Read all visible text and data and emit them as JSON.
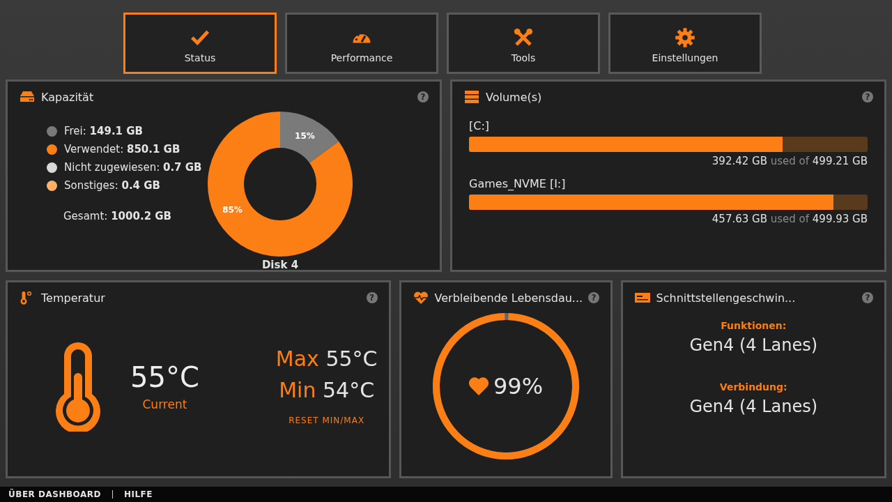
{
  "tabs": [
    {
      "label": "Status",
      "selected": true
    },
    {
      "label": "Performance",
      "selected": false
    },
    {
      "label": "Tools",
      "selected": false
    },
    {
      "label": "Einstellungen",
      "selected": false
    }
  ],
  "capacity": {
    "title": "Kapazität",
    "help": "?",
    "legend": [
      {
        "label": "Frei:",
        "value": "149.1 GB",
        "color": "#7a7a7a"
      },
      {
        "label": "Verwendet:",
        "value": "850.1 GB",
        "color": "#fb7f14"
      },
      {
        "label": "Nicht zugewiesen:",
        "value": "0.7 GB",
        "color": "#d9d9d9"
      },
      {
        "label": "Sonstiges:",
        "value": "0.4 GB",
        "color": "#fdb068"
      }
    ],
    "total_label": "Gesamt:",
    "total_value": "1000.2 GB",
    "disk": "Disk 4",
    "chart_data": {
      "type": "donut",
      "values": [
        15,
        85
      ],
      "value_labels": [
        "15%",
        "85%"
      ]
    }
  },
  "volumes": {
    "title": "Volume(s)",
    "help": "?",
    "items": [
      {
        "name": "[C:]",
        "level": 0.786,
        "used": "392.42 GB",
        "mid": "used of",
        "total": "499.21 GB"
      },
      {
        "name": "Games_NVME [I:]",
        "level": 0.915,
        "used": "457.63 GB",
        "mid": "used of",
        "total": "499.93 GB"
      }
    ]
  },
  "temperature": {
    "title": "Temperatur",
    "help": "?",
    "current": "55°C",
    "current_label": "Current",
    "max_label": "Max",
    "max": "55°C",
    "min_label": "Min",
    "min": "54°C",
    "reset": "RESET MIN/MAX"
  },
  "life": {
    "title": "Verbleibende Lebensdau...",
    "help": "?",
    "level": 0.99,
    "reading": "99%"
  },
  "interface": {
    "title": "Schnittstellengeschwin...",
    "help": "?",
    "rows": [
      {
        "label": "Funktionen:",
        "value": "Gen4 (4 Lanes)"
      },
      {
        "label": "Verbindung:",
        "value": "Gen4 (4 Lanes)"
      }
    ]
  },
  "footer": {
    "links": [
      "ÜBER DASHBOARD",
      "HILFE"
    ]
  }
}
